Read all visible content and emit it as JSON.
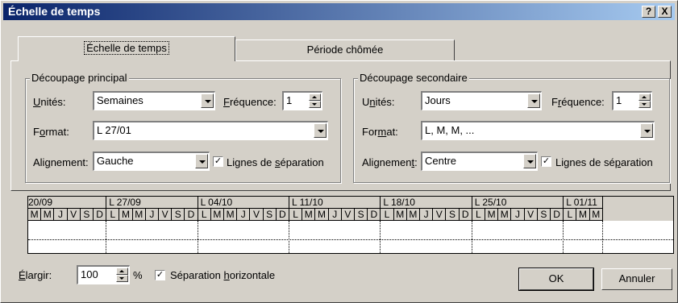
{
  "window": {
    "title": "Échelle de temps",
    "help_label": "?",
    "close_label": "X"
  },
  "tabs": [
    {
      "label": "Échelle de temps",
      "active": true
    },
    {
      "label": "Période chômée",
      "active": false
    }
  ],
  "primary": {
    "group_title": "Découpage principal",
    "units_label": "Unités:",
    "units_value": "Semaines",
    "frequency_label": "Fréquence:",
    "frequency_value": "1",
    "format_label": "Format:",
    "format_value": "L 27/01",
    "alignment_label": "Alignement:",
    "alignment_value": "Gauche",
    "separator_label": "Lignes de séparation",
    "separator_checked": true
  },
  "secondary": {
    "group_title": "Découpage secondaire",
    "units_label": "Unités:",
    "units_value": "Jours",
    "frequency_label": "Fréquence:",
    "frequency_value": "1",
    "format_label": "Format:",
    "format_value": "L, M, M, ...",
    "alignment_label": "Alignement:",
    "alignment_value": "Centre",
    "separator_label": "Lignes de séparation",
    "separator_checked": true
  },
  "preview": {
    "weeks": [
      "20/09",
      "L 27/09",
      "L 04/10",
      "L 11/10",
      "L 18/10",
      "L 25/10",
      "L 01/11"
    ],
    "first_week_days": [
      "M",
      "M",
      "J",
      "V",
      "S",
      "D"
    ],
    "week_days": [
      "L",
      "M",
      "M",
      "J",
      "V",
      "S",
      "D"
    ],
    "last_week_days": [
      "L",
      "M",
      "M"
    ]
  },
  "footer": {
    "enlarge_label": "Élargir:",
    "enlarge_value": "100",
    "percent": "%",
    "horizontal_sep_label": "Séparation horizontale",
    "horizontal_sep_checked": true,
    "ok_label": "OK",
    "cancel_label": "Annuler"
  },
  "colors": {
    "titlebar_start": "#0a246a",
    "titlebar_end": "#a6caf0",
    "face": "#d4d0c8"
  }
}
